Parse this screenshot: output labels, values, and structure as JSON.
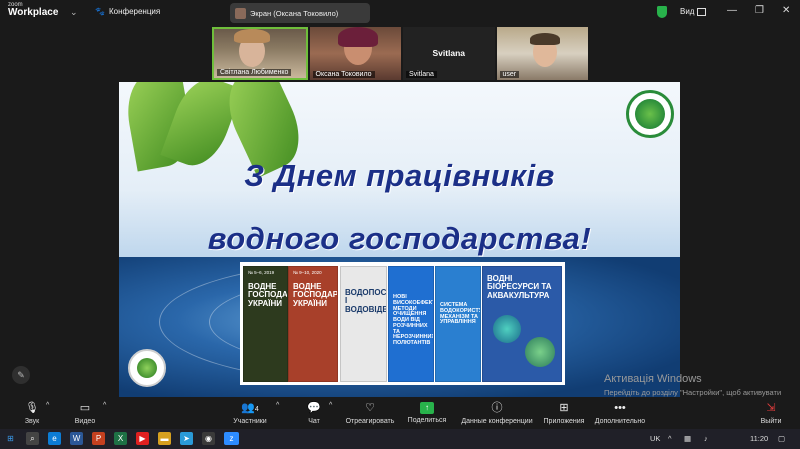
{
  "app": {
    "logo_small": "zoom",
    "logo_big": "Workplace",
    "conference_label": "Конференция",
    "screen_label": "Экран (Оксана Токовило)",
    "view_label": "Вид"
  },
  "participants": [
    {
      "name": "Світлана Любименко"
    },
    {
      "name": "Оксана Токовило"
    },
    {
      "name": "Svitlana",
      "center_name": "Svitlana"
    },
    {
      "name": "user"
    }
  ],
  "slide": {
    "title_line1": "З Днем працівників",
    "title_line2": "водного господарства!",
    "books": [
      {
        "top": "№ 5–6, 2019",
        "title": "ВОДНЕ ГОСПОДАРСТВО УКРАЇНИ",
        "color": "#2d3a1e",
        "text_color": "#ffffff"
      },
      {
        "top": "№ 9–10, 2020",
        "title": "ВОДНЕ ГОСПОДАРСТВО УКРАЇНИ",
        "color": "#a8402a",
        "text_color": "#ffffff"
      },
      {
        "top": "",
        "title": "ВОДОПОСТАЧАННЯ І ВОДОВІДВЕДЕННЯ",
        "color": "#e8e8e8",
        "text_color": "#1a3a6a"
      },
      {
        "top": "",
        "title": "НОВІ ВИСОКОЕФЕКТИВНІ МЕТОДИ ОЧИЩЕННЯ ВОДИ ВІД РОЗЧИННИХ ТА НЕРОЗЧИННИХ ПОЛЮТАНТІВ",
        "color": "#1f6fd1",
        "text_color": "#ffffff"
      },
      {
        "top": "",
        "title": "СИСТЕМА ВОДОКОРИСТУВАННЯ. МЕХАНІЗМ ТА УПРАВЛІННЯ",
        "color": "#2a7fd0",
        "text_color": "#ffffff"
      },
      {
        "top": "",
        "title": "ВОДНІ БІОРЕСУРСИ ТА АКВАКУЛЬТУРА",
        "color": "#2b5aa8",
        "text_color": "#ffffff"
      }
    ]
  },
  "watermark": {
    "line1": "Активація Windows",
    "line2": "Перейдіть до розділу \"Настройки\", щоб активувати Windows."
  },
  "toolbar": [
    {
      "label": "Звук",
      "icon": "microphone-icon"
    },
    {
      "label": "Видео",
      "icon": "video-camera-icon"
    },
    {
      "label": "Участники",
      "icon": "participants-icon",
      "count": "4"
    },
    {
      "label": "Чат",
      "icon": "chat-icon"
    },
    {
      "label": "Отреагировать",
      "icon": "heart-icon"
    },
    {
      "label": "Поделиться",
      "icon": "share-screen-icon"
    },
    {
      "label": "Данные конференции",
      "icon": "info-icon"
    },
    {
      "label": "Приложения",
      "icon": "apps-icon"
    },
    {
      "label": "Дополнительно",
      "icon": "more-icon"
    },
    {
      "label": "Выйти",
      "icon": "leave-icon"
    }
  ],
  "taskbar": {
    "lang": "UK",
    "time": "11:20"
  },
  "colors": {
    "accent_green": "#28b24b",
    "title_blue": "#1b2f87",
    "leave_red": "#e03c3c"
  }
}
